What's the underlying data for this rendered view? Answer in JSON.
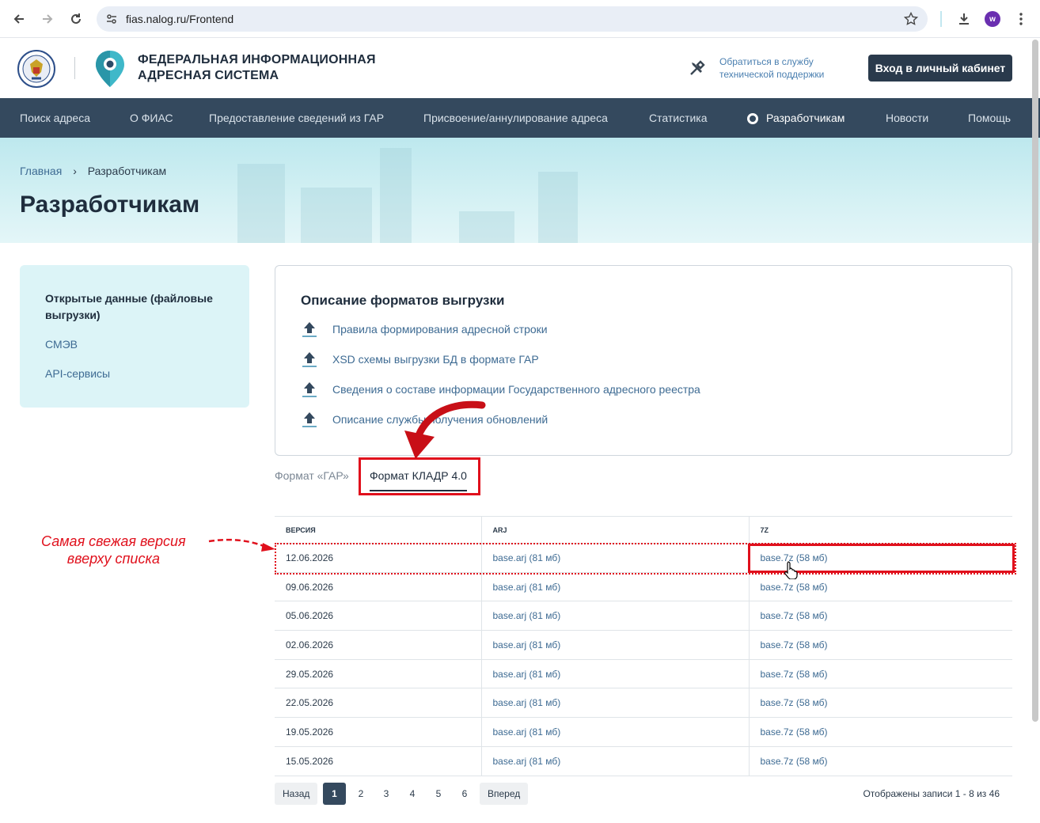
{
  "browser": {
    "url": "fias.nalog.ru/Frontend",
    "profile_initial": "w"
  },
  "header": {
    "title_line1": "ФЕДЕРАЛЬНАЯ ИНФОРМАЦИОННАЯ",
    "title_line2": "АДРЕСНАЯ СИСТЕМА",
    "support_line1": "Обратиться в службу",
    "support_line2": "технической поддержки",
    "login_label": "Вход в личный кабинет"
  },
  "nav": {
    "items": [
      "Поиск адреса",
      "О ФИАС",
      "Предоставление сведений из ГАР",
      "Присвоение/аннулирование адреса",
      "Статистика",
      "Разработчикам",
      "Новости",
      "Помощь"
    ],
    "active_index": 5
  },
  "breadcrumb": {
    "home": "Главная",
    "current": "Разработчикам"
  },
  "page_title": "Разработчикам",
  "sidebar": {
    "items": [
      "Открытые данные (файловые выгрузки)",
      "СМЭВ",
      "API-сервисы"
    ]
  },
  "formats": {
    "heading": "Описание форматов выгрузки",
    "links": [
      "Правила формирования адресной строки",
      "XSD схемы выгрузки БД в формате ГАР",
      "Сведения о составе информации Государственного адресного реестра",
      "Описание службы получения обновлений"
    ]
  },
  "tabs": {
    "inactive": "Формат «ГАР»",
    "active": "Формат КЛАДР 4.0"
  },
  "table": {
    "headers": [
      "ВЕРСИЯ",
      "ARJ",
      "7Z"
    ],
    "rows": [
      [
        "12.06.2026",
        "base.arj (81 мб)",
        "base.7z (58 мб)"
      ],
      [
        "09.06.2026",
        "base.arj (81 мб)",
        "base.7z (58 мб)"
      ],
      [
        "05.06.2026",
        "base.arj (81 мб)",
        "base.7z (58 мб)"
      ],
      [
        "02.06.2026",
        "base.arj (81 мб)",
        "base.7z (58 мб)"
      ],
      [
        "29.05.2026",
        "base.arj (81 мб)",
        "base.7z (58 мб)"
      ],
      [
        "22.05.2026",
        "base.arj (81 мб)",
        "base.7z (58 мб)"
      ],
      [
        "19.05.2026",
        "base.arj (81 мб)",
        "base.7z (58 мб)"
      ],
      [
        "15.05.2026",
        "base.arj (81 мб)",
        "base.7z (58 мб)"
      ]
    ]
  },
  "pager": {
    "prev": "Назад",
    "pages": [
      "1",
      "2",
      "3",
      "4",
      "5",
      "6"
    ],
    "current": "1",
    "next": "Вперед",
    "records_text": "Отображены записи 1 - 8 из 46"
  },
  "annotation": {
    "line1": "Самая свежая версия",
    "line2": "вверху списка"
  },
  "colors": {
    "accent_red": "#e0101c",
    "nav_bg": "#34495e",
    "link": "#3e6b93"
  }
}
